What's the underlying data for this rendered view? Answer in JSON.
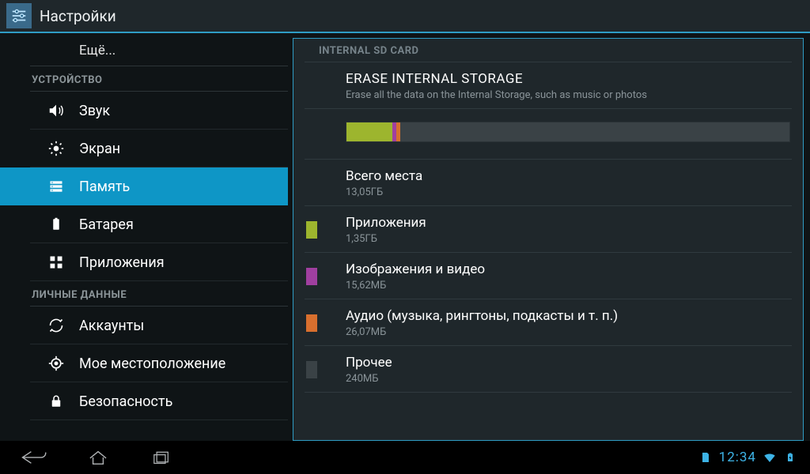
{
  "header": {
    "title": "Настройки"
  },
  "sidebar": {
    "more": "Ещё...",
    "section_device": "УСТРОЙСТВО",
    "section_personal": "ЛИЧНЫЕ ДАННЫЕ",
    "items": {
      "sound": "Звук",
      "display": "Экран",
      "storage": "Память",
      "battery": "Батарея",
      "apps": "Приложения",
      "accounts": "Аккаунты",
      "location": "Мое местоположение",
      "security": "Безопасность"
    }
  },
  "main": {
    "section_header": "INTERNAL SD CARD",
    "erase_title": "ERASE INTERNAL STORAGE",
    "erase_subtitle": "Erase all the data on the Internal Storage, such as music or photos",
    "total_label": "Всего места",
    "total_value": "13,05ГБ",
    "categories": [
      {
        "label": "Приложения",
        "value": "1,35ГБ",
        "color": "#9db52e"
      },
      {
        "label": "Изображения и видео",
        "value": "15,62МБ",
        "color": "#a03fa0"
      },
      {
        "label": "Аудио (музыка, рингтоны, подкасты и т. п.)",
        "value": "26,07МБ",
        "color": "#d86f2e"
      },
      {
        "label": "Прочее",
        "value": "240МБ",
        "color": "#3a4246"
      }
    ],
    "usage_segments": [
      {
        "color": "#9db52e",
        "pct": 10.3
      },
      {
        "color": "#a03fa0",
        "pct": 0.9
      },
      {
        "color": "#d86f2e",
        "pct": 1.0
      }
    ]
  },
  "status": {
    "time": "12:34"
  },
  "colors": {
    "accent": "#0e96c6"
  }
}
